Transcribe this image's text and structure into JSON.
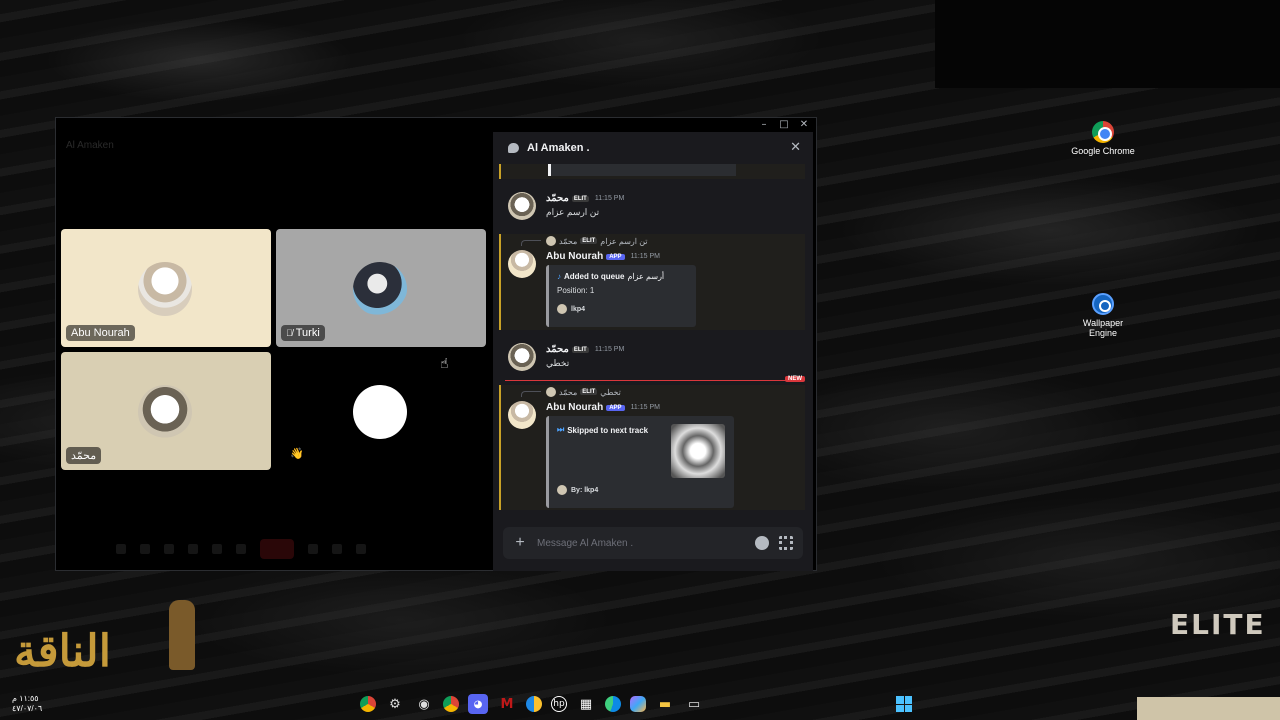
{
  "desktop": {
    "icons": [
      {
        "label": "Google Chrome",
        "icon": "chrome-icon"
      },
      {
        "label": "Wallpaper Engine",
        "icon": "wallpaper-engine-icon"
      }
    ]
  },
  "window": {
    "faded_title": "Al Amaken",
    "controls": {
      "minimize": "–",
      "maximize": "□",
      "close": "✕"
    },
    "participants": [
      {
        "name": "Abu Nourah",
        "muted": false
      },
      {
        "name": "Turki",
        "muted": true
      },
      {
        "name": "محمّد",
        "muted": false
      },
      {
        "name": "",
        "reaction": "👋"
      }
    ]
  },
  "chat": {
    "title": "Al Amaken .",
    "close_icon": "close-icon",
    "messages": [
      {
        "author": "محمّد",
        "badge": "ELIT",
        "time": "11:15 PM",
        "text": "تن ارسم عزام"
      },
      {
        "reply_to": {
          "author": "محمّد",
          "badge": "ELIT",
          "text": "تن ارسم عزام"
        },
        "author": "Abu Nourah",
        "badge": "APP",
        "time": "11:15 PM",
        "embed": {
          "title": "Added to queue",
          "title_suffix": "أرسم عزام",
          "line": "Position: 1",
          "footer": "lkp4"
        }
      },
      {
        "author": "محمّد",
        "badge": "ELIT",
        "time": "11:15 PM",
        "text": "تخطي"
      },
      {
        "reply_to": {
          "author": "محمّد",
          "badge": "ELIT",
          "text": "تخطي"
        },
        "author": "Abu Nourah",
        "badge": "APP",
        "time": "11:15 PM",
        "embed": {
          "title": "Skipped to next track",
          "footer": "By: lkp4"
        }
      }
    ],
    "new_label": "NEW",
    "composer": {
      "placeholder": "Message Al Amaken ."
    }
  },
  "clock": {
    "time": "١١:٥٥ م",
    "date": "٤٧/٠٧/٠٦"
  },
  "branding": {
    "left_logo": "الناقة",
    "right_logo": "ELITE"
  },
  "taskbar": {
    "icons": [
      "chrome-icon",
      "settings-icon",
      "obs-icon",
      "chrome-icon",
      "discord-icon",
      "mcafee-icon",
      "chrome-alt-icon",
      "hp-icon",
      "store-icon",
      "edge-icon",
      "copilot-icon",
      "file-explorer-icon",
      "window-icon"
    ]
  }
}
